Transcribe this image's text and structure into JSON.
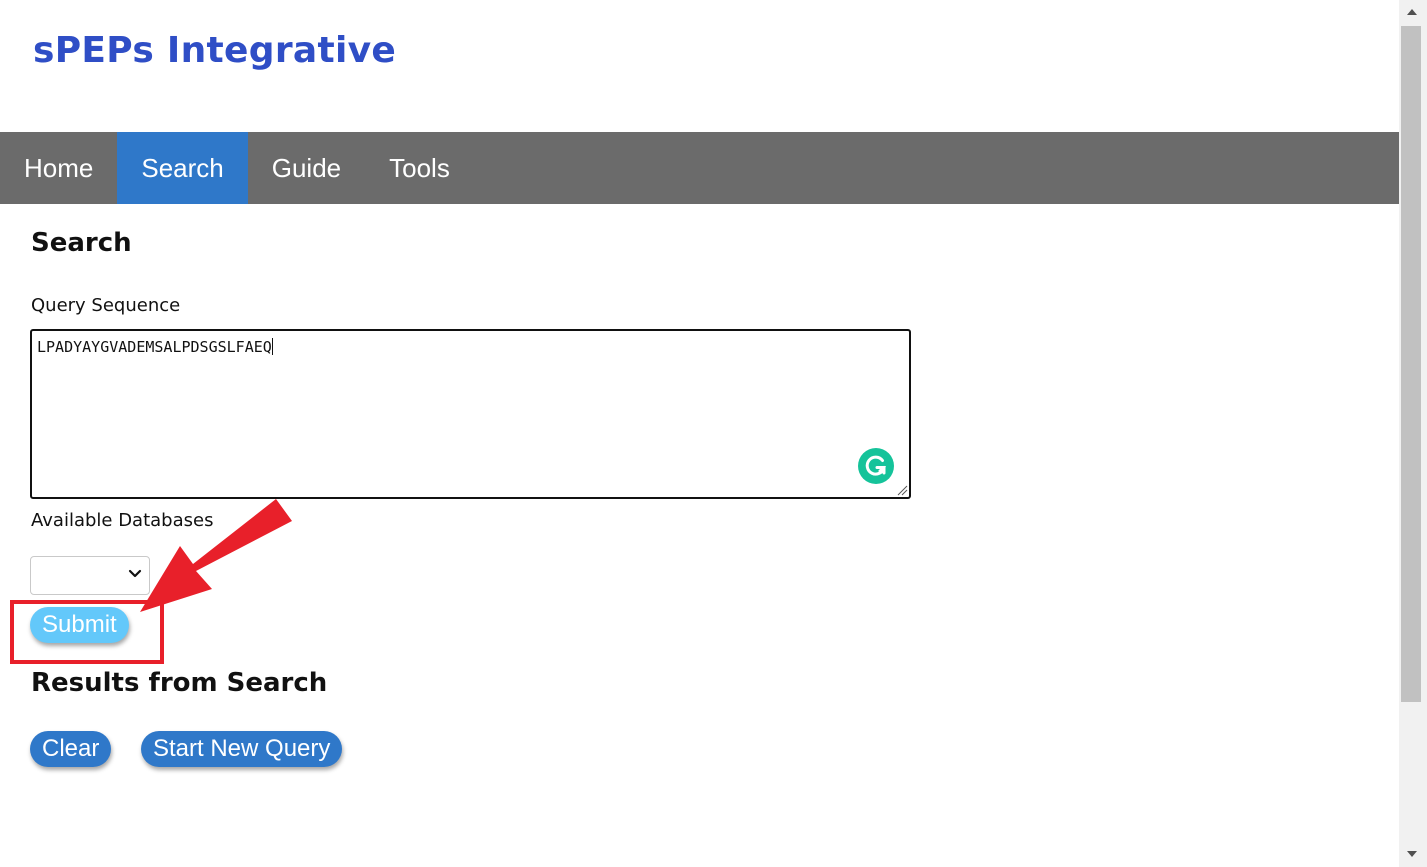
{
  "header": {
    "site_title": "sPEPs Integrative"
  },
  "nav": {
    "items": [
      {
        "label": "Home",
        "active": false
      },
      {
        "label": "Search",
        "active": true
      },
      {
        "label": "Guide",
        "active": false
      },
      {
        "label": "Tools",
        "active": false
      }
    ]
  },
  "search": {
    "title": "Search",
    "query_label": "Query Sequence",
    "query_value": "LPADYAYGVADEMSALPDSGSLFAEQ",
    "databases_label": "Available Databases",
    "databases_selected": "",
    "submit_label": "Submit"
  },
  "results": {
    "title": "Results from Search",
    "clear_label": "Clear",
    "new_query_label": "Start New Query"
  },
  "colors": {
    "brand_title": "#2f4ec6",
    "nav_bg": "#6b6b6b",
    "nav_active": "#2f78c9",
    "submit_bg": "#63c8fa",
    "button_bg": "#2f78c9",
    "annotation_red": "#e8202a",
    "grammarly_green": "#15c39a"
  },
  "icons": {
    "grammarly": "grammarly-icon",
    "select_chevron": "chevron-down-icon",
    "annotation_arrow": "red-arrow-annotation"
  }
}
